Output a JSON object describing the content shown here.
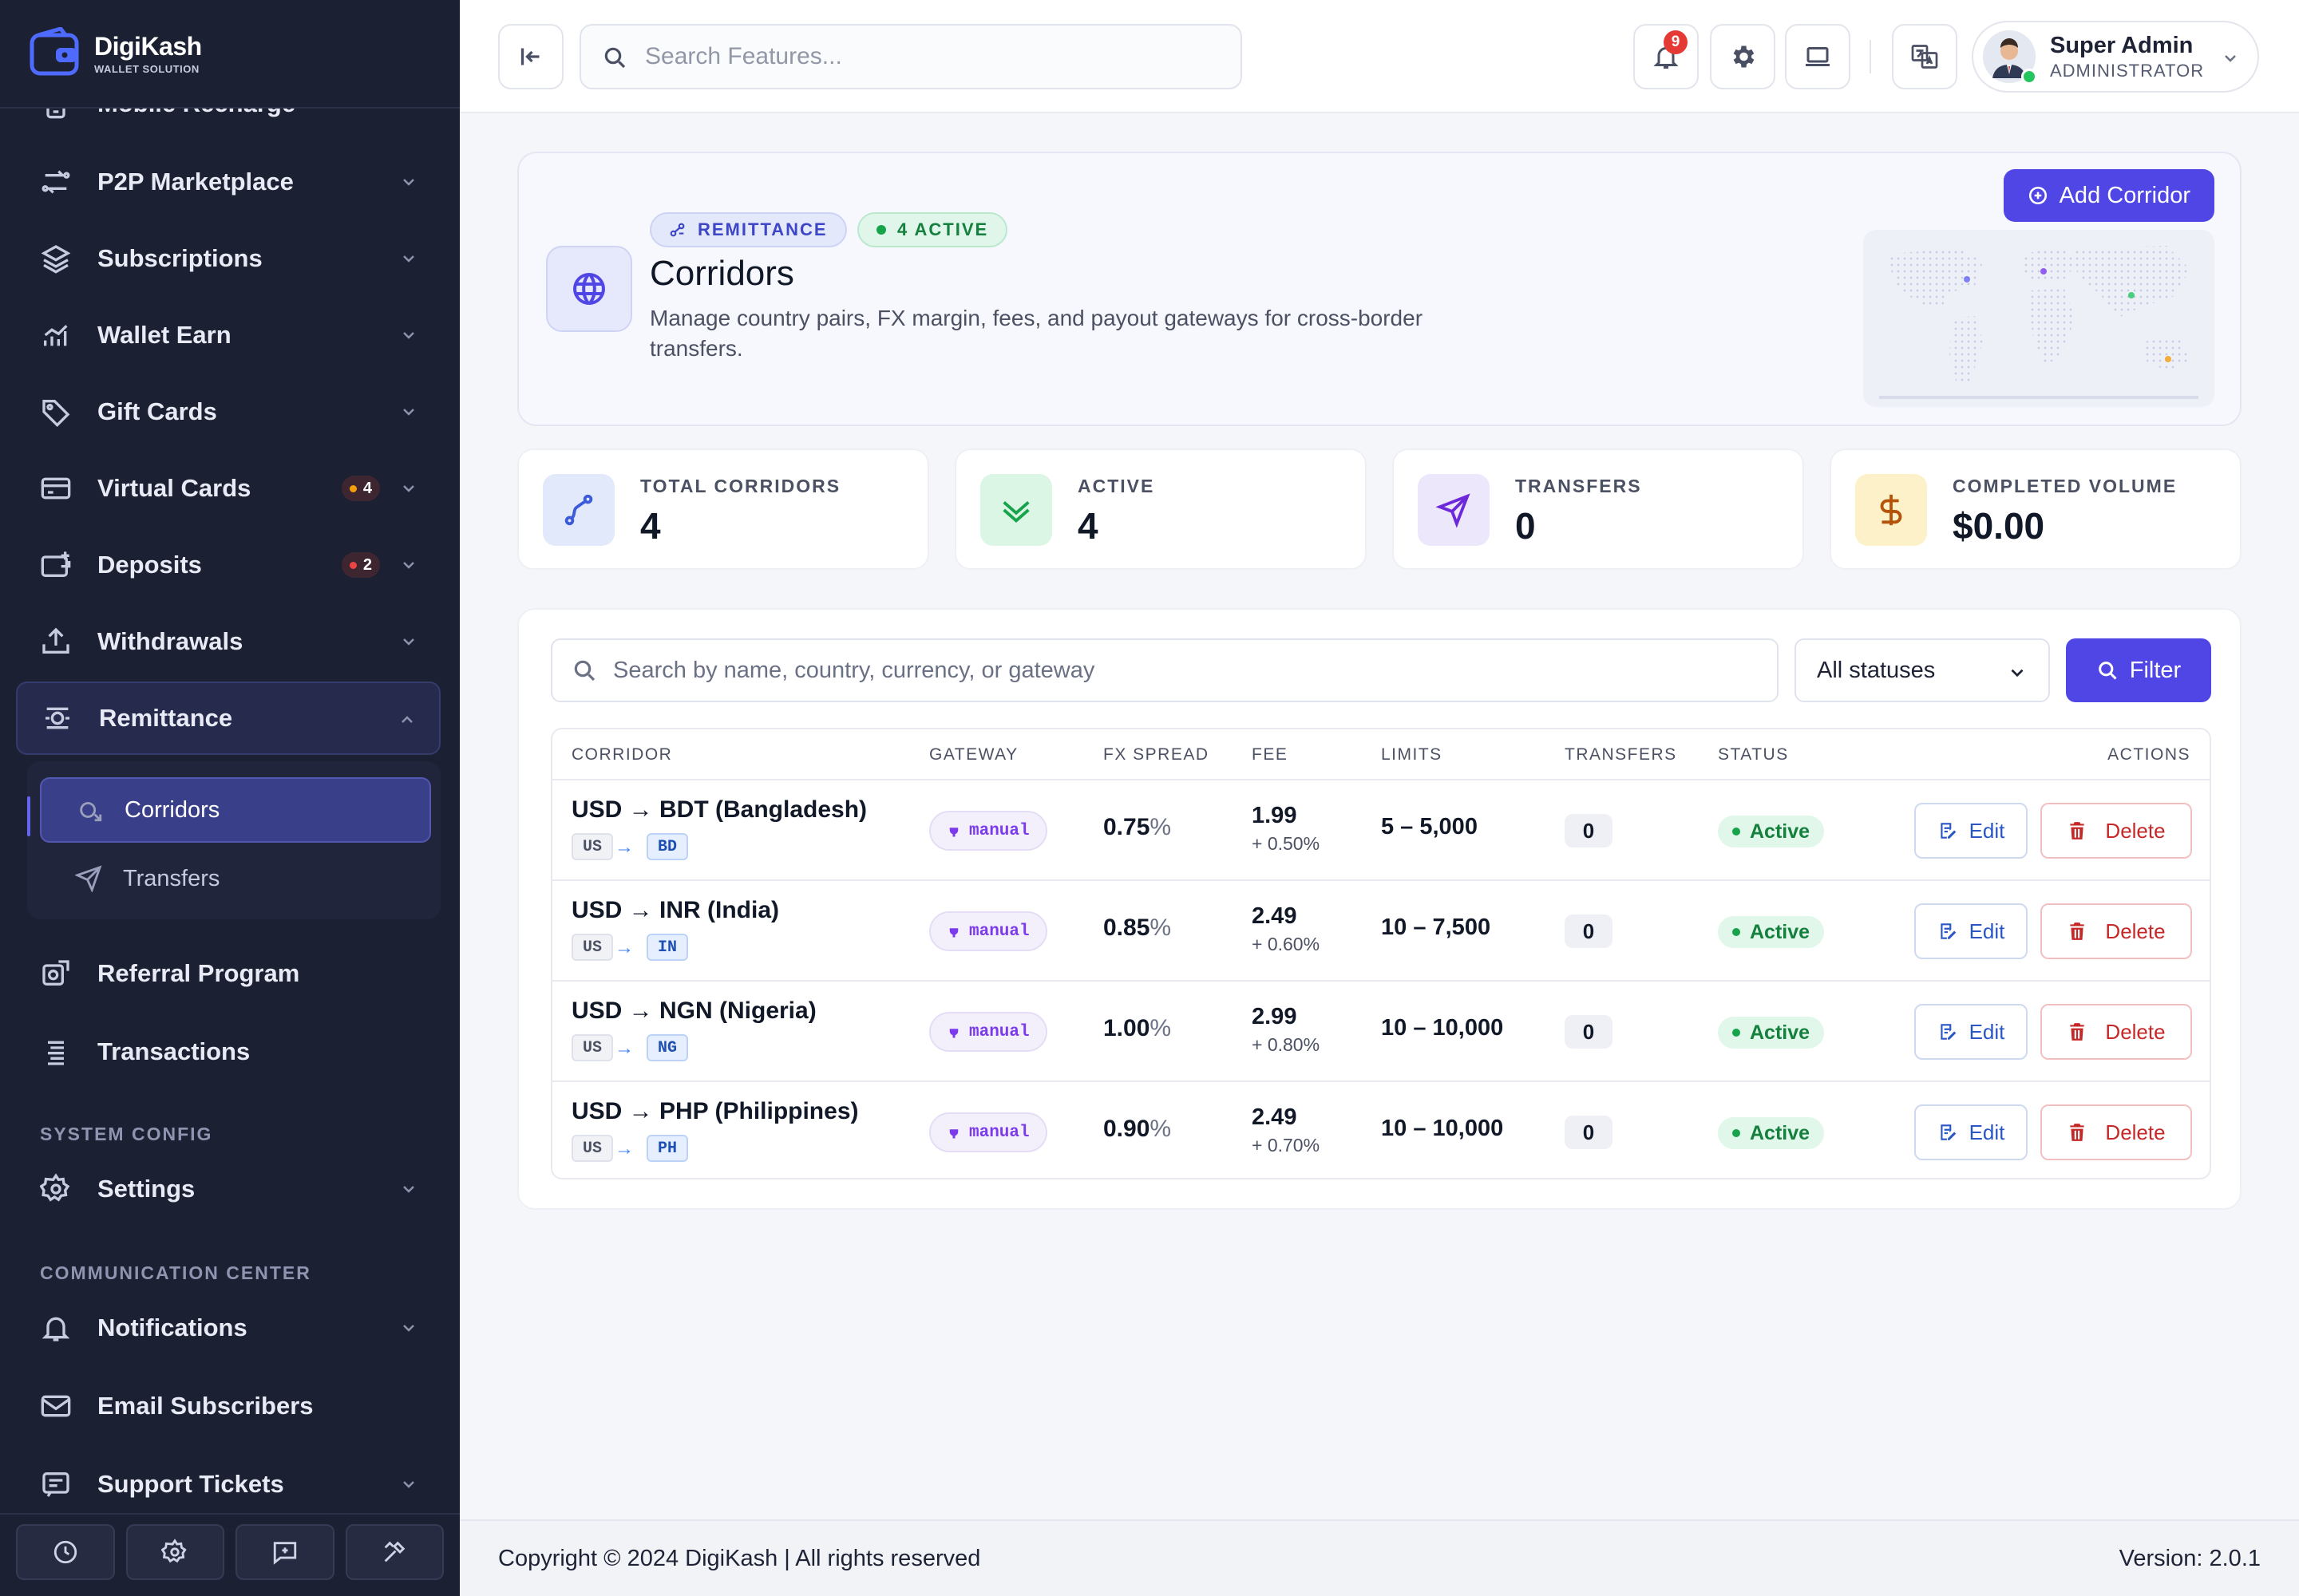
{
  "brand": {
    "name": "DigiKash",
    "tagline": "WALLET SOLUTION"
  },
  "sidebar": {
    "items": [
      {
        "label": "Mobile Recharge",
        "icon": "phone-icon"
      },
      {
        "label": "P2P Marketplace",
        "icon": "exchange-icon"
      },
      {
        "label": "Subscriptions",
        "icon": "layers-icon"
      },
      {
        "label": "Wallet Earn",
        "icon": "chart-icon"
      },
      {
        "label": "Gift Cards",
        "icon": "tag-icon"
      },
      {
        "label": "Virtual Cards",
        "icon": "card-icon",
        "badge": "4"
      },
      {
        "label": "Deposits",
        "icon": "wallet-icon",
        "badge": "2"
      },
      {
        "label": "Withdrawals",
        "icon": "upload-icon"
      },
      {
        "label": "Remittance",
        "icon": "remit-icon"
      },
      {
        "label": "Referral Program",
        "icon": "referral-icon"
      },
      {
        "label": "Transactions",
        "icon": "list-icon"
      },
      {
        "label": "Settings",
        "icon": "gear-icon"
      },
      {
        "label": "Notifications",
        "icon": "bell-icon"
      },
      {
        "label": "Email Subscribers",
        "icon": "mail-icon"
      },
      {
        "label": "Support Tickets",
        "icon": "ticket-icon"
      }
    ],
    "remittance_sub": [
      {
        "label": "Corridors"
      },
      {
        "label": "Transfers"
      }
    ],
    "section_system": "SYSTEM CONFIG",
    "section_comm": "COMMUNICATION CENTER",
    "footer_icons": [
      "clock-icon",
      "gear-icon",
      "chat-icon",
      "tools-icon"
    ]
  },
  "topbar": {
    "search_placeholder": "Search Features...",
    "notification_count": "9",
    "user_name": "Super Admin",
    "user_role": "ADMINISTRATOR"
  },
  "hero": {
    "tag": "REMITTANCE",
    "active_tag": "4 ACTIVE",
    "title": "Corridors",
    "description": "Manage country pairs, FX margin, fees, and payout gateways for cross-border transfers.",
    "add_button": "Add Corridor"
  },
  "stats": [
    {
      "label": "TOTAL CORRIDORS",
      "value": "4",
      "color": "#3b5bdb"
    },
    {
      "label": "ACTIVE",
      "value": "4",
      "color": "#16a34a"
    },
    {
      "label": "TRANSFERS",
      "value": "0",
      "color": "#6d28d9"
    },
    {
      "label": "COMPLETED VOLUME",
      "value": "$0.00",
      "color": "#b45309"
    }
  ],
  "filters": {
    "search_placeholder": "Search by name, country, currency, or gateway",
    "status_select": "All statuses",
    "filter_button": "Filter"
  },
  "table": {
    "headers": [
      "CORRIDOR",
      "GATEWAY",
      "FX SPREAD",
      "FEE",
      "LIMITS",
      "TRANSFERS",
      "STATUS",
      "ACTIONS"
    ],
    "rows": [
      {
        "name": "USD → BDT (Bangladesh)",
        "from": "US",
        "to": "BD",
        "gateway": "manual",
        "fx": "0.75",
        "fx_unit": "%",
        "fee": "1.99",
        "fee_pct": "+ 0.50%",
        "limits": "5 – 5,000",
        "transfers": "0",
        "status": "Active",
        "edit": "Edit",
        "delete": "Delete"
      },
      {
        "name": "USD → INR (India)",
        "from": "US",
        "to": "IN",
        "gateway": "manual",
        "fx": "0.85",
        "fx_unit": "%",
        "fee": "2.49",
        "fee_pct": "+ 0.60%",
        "limits": "10 – 7,500",
        "transfers": "0",
        "status": "Active",
        "edit": "Edit",
        "delete": "Delete"
      },
      {
        "name": "USD → NGN (Nigeria)",
        "from": "US",
        "to": "NG",
        "gateway": "manual",
        "fx": "1.00",
        "fx_unit": "%",
        "fee": "2.99",
        "fee_pct": "+ 0.80%",
        "limits": "10 – 10,000",
        "transfers": "0",
        "status": "Active",
        "edit": "Edit",
        "delete": "Delete"
      },
      {
        "name": "USD → PHP (Philippines)",
        "from": "US",
        "to": "PH",
        "gateway": "manual",
        "fx": "0.90",
        "fx_unit": "%",
        "fee": "2.49",
        "fee_pct": "+ 0.70%",
        "limits": "10 – 10,000",
        "transfers": "0",
        "status": "Active",
        "edit": "Edit",
        "delete": "Delete"
      }
    ]
  },
  "footer": {
    "copyright": "Copyright © 2024 DigiKash | All rights reserved",
    "version": "Version: 2.0.1"
  },
  "colors": {
    "accent": "#4f46e5",
    "sidebar": "#1c2033",
    "active_green": "#16a34a",
    "danger": "#c62828"
  }
}
